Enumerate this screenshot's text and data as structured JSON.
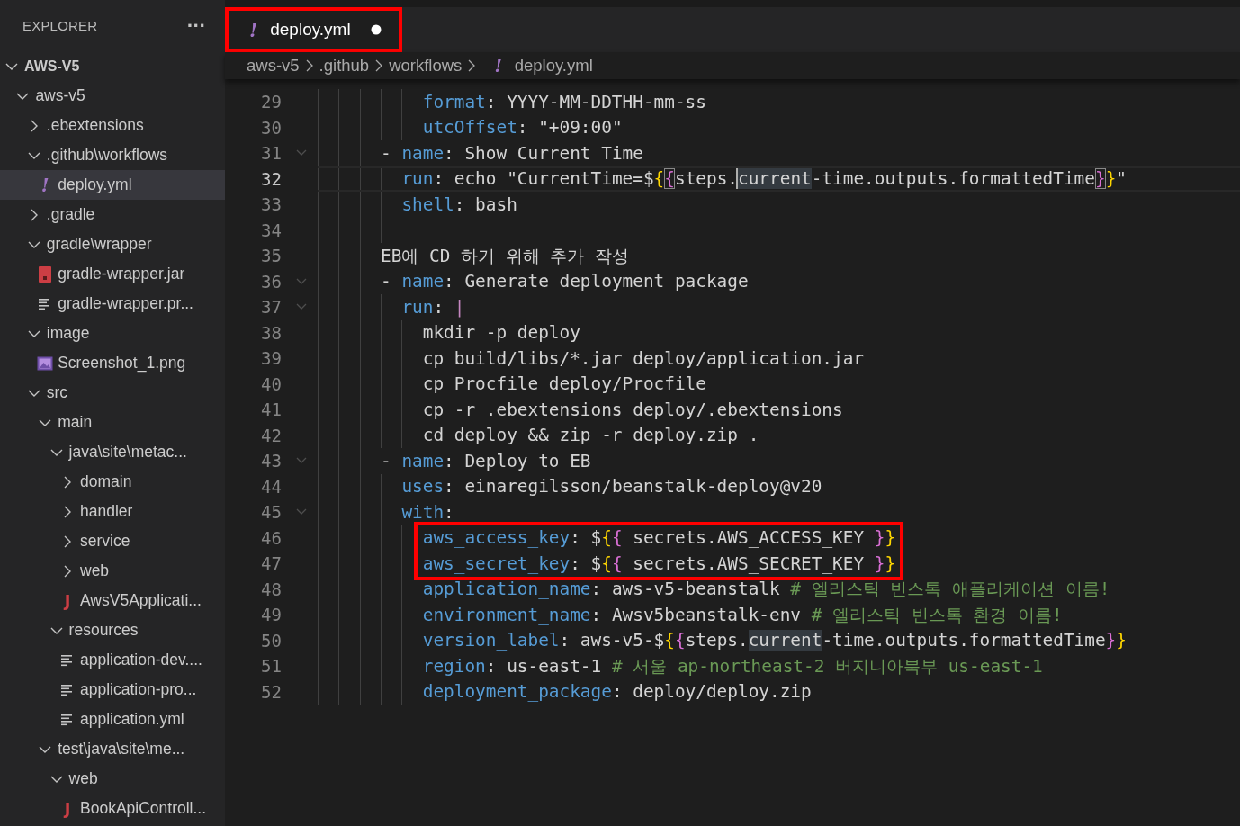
{
  "sidebar": {
    "title": "EXPLORER",
    "more": "···",
    "tree": [
      {
        "label": "AWS-V5",
        "kind": "root",
        "expanded": true,
        "selected": false,
        "children": [
          {
            "label": "aws-v5",
            "kind": "folder",
            "expanded": true,
            "selected": false,
            "children": [
              {
                "label": ".ebextensions",
                "kind": "folder",
                "expanded": false,
                "selected": false
              },
              {
                "label": ".github\\workflows",
                "kind": "folder",
                "expanded": true,
                "selected": false,
                "children": [
                  {
                    "label": "deploy.yml",
                    "kind": "yaml",
                    "glyph": "!",
                    "selected": true
                  }
                ]
              },
              {
                "label": ".gradle",
                "kind": "folder",
                "expanded": false,
                "selected": false
              },
              {
                "label": "gradle\\wrapper",
                "kind": "folder",
                "expanded": true,
                "selected": false,
                "children": [
                  {
                    "label": "gradle-wrapper.jar",
                    "kind": "jar",
                    "selected": false
                  },
                  {
                    "label": "gradle-wrapper.pr...",
                    "kind": "lines",
                    "selected": false
                  }
                ]
              },
              {
                "label": "image",
                "kind": "folder",
                "expanded": true,
                "selected": false,
                "children": [
                  {
                    "label": "Screenshot_1.png",
                    "kind": "image",
                    "selected": false
                  }
                ]
              },
              {
                "label": "src",
                "kind": "folder",
                "expanded": true,
                "selected": false,
                "children": [
                  {
                    "label": "main",
                    "kind": "folder",
                    "expanded": true,
                    "selected": false,
                    "children": [
                      {
                        "label": "java\\site\\metac...",
                        "kind": "folder",
                        "expanded": true,
                        "selected": false,
                        "children": [
                          {
                            "label": "domain",
                            "kind": "folder",
                            "expanded": false,
                            "selected": false
                          },
                          {
                            "label": "handler",
                            "kind": "folder",
                            "expanded": false,
                            "selected": false
                          },
                          {
                            "label": "service",
                            "kind": "folder",
                            "expanded": false,
                            "selected": false
                          },
                          {
                            "label": "web",
                            "kind": "folder",
                            "expanded": false,
                            "selected": false
                          },
                          {
                            "label": "AwsV5Applicati...",
                            "kind": "java",
                            "glyph": "J",
                            "selected": false
                          }
                        ]
                      },
                      {
                        "label": "resources",
                        "kind": "folder",
                        "expanded": true,
                        "selected": false,
                        "children": [
                          {
                            "label": "application-dev....",
                            "kind": "lines",
                            "selected": false
                          },
                          {
                            "label": "application-pro...",
                            "kind": "lines",
                            "selected": false
                          },
                          {
                            "label": "application.yml",
                            "kind": "lines",
                            "selected": false
                          }
                        ]
                      }
                    ]
                  },
                  {
                    "label": "test\\java\\site\\me...",
                    "kind": "folder",
                    "expanded": true,
                    "selected": false,
                    "children": [
                      {
                        "label": "web",
                        "kind": "folder",
                        "expanded": true,
                        "selected": false,
                        "children": [
                          {
                            "label": "BookApiControll...",
                            "kind": "java",
                            "glyph": "J",
                            "selected": false
                          }
                        ]
                      }
                    ]
                  }
                ]
              }
            ]
          }
        ]
      }
    ]
  },
  "tabs": [
    {
      "label": "deploy.yml",
      "glyph": "!",
      "selected": true,
      "modified": true,
      "annotated": true
    }
  ],
  "breadcrumbs": [
    {
      "label": "aws-v5"
    },
    {
      "label": ".github"
    },
    {
      "label": "workflows"
    },
    {
      "label": "deploy.yml",
      "glyph": "!"
    }
  ],
  "editor": {
    "lines": [
      {
        "number": "29",
        "fold": false,
        "current": false,
        "annotated": false,
        "tokens": [
          {
            "text": "          format",
            "kind": "key"
          },
          {
            "text": ": YYYY-MM-DDTHH-mm-ss",
            "kind": "plain"
          }
        ]
      },
      {
        "number": "30",
        "fold": false,
        "current": false,
        "annotated": false,
        "tokens": [
          {
            "text": "          utcOffset",
            "kind": "key"
          },
          {
            "text": ": \"+09:00\"",
            "kind": "plain"
          }
        ]
      },
      {
        "number": "31",
        "fold": true,
        "current": false,
        "annotated": false,
        "tokens": [
          {
            "text": "      - ",
            "kind": "plain"
          },
          {
            "text": "name",
            "kind": "key"
          },
          {
            "text": ": Show Current Time",
            "kind": "plain"
          }
        ]
      },
      {
        "number": "32",
        "fold": false,
        "current": true,
        "annotated": false,
        "tokens": [
          {
            "text": "        run",
            "kind": "key"
          },
          {
            "text": ": echo \"CurrentTime=$",
            "kind": "plain"
          },
          {
            "text": "{",
            "kind": "brace1"
          },
          {
            "text": "{",
            "kind": "brace2",
            "bracket_match": true
          },
          {
            "text": "steps.",
            "kind": "plain"
          },
          {
            "text": "current",
            "kind": "plain",
            "word_highlight": true,
            "cursor": true
          },
          {
            "text": "-time.outputs.formattedTime",
            "kind": "plain"
          },
          {
            "text": "}",
            "kind": "brace2",
            "bracket_match": true
          },
          {
            "text": "}",
            "kind": "brace1"
          },
          {
            "text": "\"",
            "kind": "plain"
          }
        ]
      },
      {
        "number": "33",
        "fold": false,
        "current": false,
        "annotated": false,
        "tokens": [
          {
            "text": "        shell",
            "kind": "key"
          },
          {
            "text": ": bash",
            "kind": "plain"
          }
        ]
      },
      {
        "number": "34",
        "fold": false,
        "current": false,
        "annotated": false
      },
      {
        "number": "35",
        "fold": false,
        "current": false,
        "annotated": false,
        "tokens": [
          {
            "text": "      EB에 CD 하기 위해 추가 작성",
            "kind": "plain"
          }
        ]
      },
      {
        "number": "36",
        "fold": true,
        "current": false,
        "annotated": false,
        "tokens": [
          {
            "text": "      - ",
            "kind": "plain"
          },
          {
            "text": "name",
            "kind": "key"
          },
          {
            "text": ": Generate deployment package",
            "kind": "plain"
          }
        ]
      },
      {
        "number": "37",
        "fold": true,
        "current": false,
        "annotated": false,
        "tokens": [
          {
            "text": "        run",
            "kind": "key"
          },
          {
            "text": ": ",
            "kind": "plain"
          },
          {
            "text": "|",
            "kind": "indicator"
          }
        ]
      },
      {
        "number": "38",
        "fold": false,
        "current": false,
        "annotated": false,
        "tokens": [
          {
            "text": "          mkdir -p deploy",
            "kind": "plain"
          }
        ]
      },
      {
        "number": "39",
        "fold": false,
        "current": false,
        "annotated": false,
        "tokens": [
          {
            "text": "          cp build/libs/*.jar deploy/application.jar",
            "kind": "plain"
          }
        ]
      },
      {
        "number": "40",
        "fold": false,
        "current": false,
        "annotated": false,
        "tokens": [
          {
            "text": "          cp Procfile deploy/Procfile",
            "kind": "plain"
          }
        ]
      },
      {
        "number": "41",
        "fold": false,
        "current": false,
        "annotated": false,
        "tokens": [
          {
            "text": "          cp -r .ebextensions deploy/.ebextensions",
            "kind": "plain"
          }
        ]
      },
      {
        "number": "42",
        "fold": false,
        "current": false,
        "annotated": false,
        "tokens": [
          {
            "text": "          cd deploy && zip -r deploy.zip .",
            "kind": "plain"
          }
        ]
      },
      {
        "number": "43",
        "fold": true,
        "current": false,
        "annotated": false,
        "tokens": [
          {
            "text": "      - ",
            "kind": "plain"
          },
          {
            "text": "name",
            "kind": "key"
          },
          {
            "text": ": Deploy to EB",
            "kind": "plain"
          }
        ]
      },
      {
        "number": "44",
        "fold": false,
        "current": false,
        "annotated": false,
        "tokens": [
          {
            "text": "        uses",
            "kind": "key"
          },
          {
            "text": ": einaregilsson/beanstalk-deploy@v20",
            "kind": "plain"
          }
        ]
      },
      {
        "number": "45",
        "fold": true,
        "current": false,
        "annotated": false,
        "tokens": [
          {
            "text": "        with",
            "kind": "key"
          },
          {
            "text": ":",
            "kind": "plain"
          }
        ]
      },
      {
        "number": "46",
        "fold": false,
        "current": false,
        "annotated": true,
        "tokens": [
          {
            "text": "          aws_access_key",
            "kind": "key"
          },
          {
            "text": ": $",
            "kind": "plain"
          },
          {
            "text": "{",
            "kind": "brace1"
          },
          {
            "text": "{",
            "kind": "brace2"
          },
          {
            "text": " secrets.AWS_ACCESS_KEY ",
            "kind": "plain"
          },
          {
            "text": "}",
            "kind": "brace2"
          },
          {
            "text": "}",
            "kind": "brace1"
          }
        ]
      },
      {
        "number": "47",
        "fold": false,
        "current": false,
        "annotated": true,
        "tokens": [
          {
            "text": "          aws_secret_key",
            "kind": "key"
          },
          {
            "text": ": $",
            "kind": "plain"
          },
          {
            "text": "{",
            "kind": "brace1"
          },
          {
            "text": "{",
            "kind": "brace2"
          },
          {
            "text": " secrets.AWS_SECRET_KEY ",
            "kind": "plain"
          },
          {
            "text": "}",
            "kind": "brace2"
          },
          {
            "text": "}",
            "kind": "brace1"
          }
        ]
      },
      {
        "number": "48",
        "fold": false,
        "current": false,
        "annotated": false,
        "tokens": [
          {
            "text": "          application_name",
            "kind": "key"
          },
          {
            "text": ": aws-v5-beanstalk ",
            "kind": "plain"
          },
          {
            "text": "# 엘리스틱 빈스톡 애플리케이션 이름!",
            "kind": "comment"
          }
        ]
      },
      {
        "number": "49",
        "fold": false,
        "current": false,
        "annotated": false,
        "tokens": [
          {
            "text": "          environment_name",
            "kind": "key"
          },
          {
            "text": ": Awsv5beanstalk-env ",
            "kind": "plain"
          },
          {
            "text": "# 엘리스틱 빈스톡 환경 이름!",
            "kind": "comment"
          }
        ]
      },
      {
        "number": "50",
        "fold": false,
        "current": false,
        "annotated": false,
        "tokens": [
          {
            "text": "          version_label",
            "kind": "key"
          },
          {
            "text": ": aws-v5-$",
            "kind": "plain"
          },
          {
            "text": "{",
            "kind": "brace1"
          },
          {
            "text": "{",
            "kind": "brace2"
          },
          {
            "text": "steps.",
            "kind": "plain"
          },
          {
            "text": "current",
            "kind": "plain",
            "word_highlight": true
          },
          {
            "text": "-time.outputs.formattedTime",
            "kind": "plain"
          },
          {
            "text": "}",
            "kind": "brace2"
          },
          {
            "text": "}",
            "kind": "brace1"
          }
        ]
      },
      {
        "number": "51",
        "fold": false,
        "current": false,
        "annotated": false,
        "tokens": [
          {
            "text": "          region",
            "kind": "key"
          },
          {
            "text": ": us-east-1 ",
            "kind": "plain"
          },
          {
            "text": "# 서울 ap-northeast-2 버지니아북부 us-east-1",
            "kind": "comment"
          }
        ]
      },
      {
        "number": "52",
        "fold": false,
        "current": false,
        "annotated": false,
        "tokens": [
          {
            "text": "          deployment_package",
            "kind": "key"
          },
          {
            "text": ": deploy/deploy.zip",
            "kind": "plain"
          }
        ]
      }
    ]
  }
}
